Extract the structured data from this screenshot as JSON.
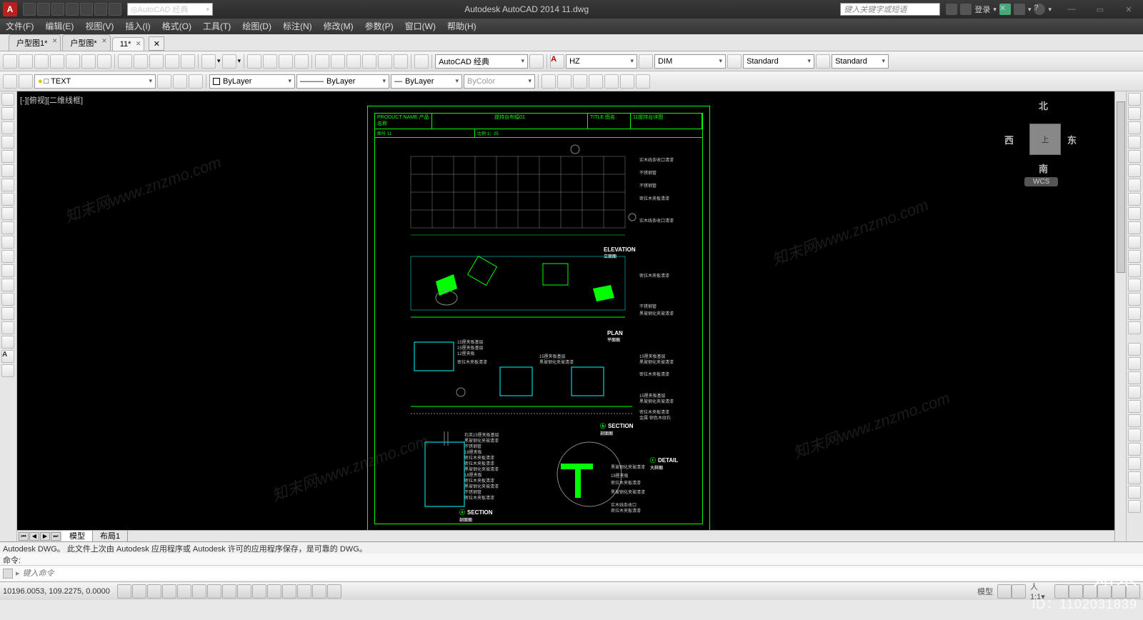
{
  "titlebar": {
    "logo": "A",
    "workspace": "AutoCAD 经典",
    "app_title": "Autodesk AutoCAD 2014   11.dwg",
    "search_placeholder": "键入关键字或短语",
    "login_label": "登录",
    "min": "—",
    "max": "▭",
    "close": "✕"
  },
  "menubar": [
    "文件(F)",
    "编辑(E)",
    "视图(V)",
    "插入(I)",
    "格式(O)",
    "工具(T)",
    "绘图(D)",
    "标注(N)",
    "修改(M)",
    "参数(P)",
    "窗口(W)",
    "帮助(H)"
  ],
  "filetabs": [
    {
      "label": "户型图1*",
      "active": false
    },
    {
      "label": "户型图*",
      "active": false
    },
    {
      "label": "11*",
      "active": true
    }
  ],
  "row1": {
    "workspace_dd": "AutoCAD 经典",
    "font": "HZ",
    "dim": "DIM",
    "std1": "Standard",
    "std2": "Standard"
  },
  "row2": {
    "text_layer": "□ TEXT",
    "layer": "ByLayer",
    "ltype": "ByLayer",
    "lweight": "ByLayer",
    "plot": "ByColor"
  },
  "canvas": {
    "label": "[-][俯视][二维线框]",
    "viewcube": {
      "n": "北",
      "s": "南",
      "e": "东",
      "w": "西",
      "top": "上",
      "wcs": "WCS"
    },
    "model_tabs": [
      "模型",
      "布局1"
    ]
  },
  "drawing": {
    "header": {
      "prodname_lbl": "PRODUCT NAME\n产品名称",
      "title": "提持台布幅01",
      "title_lbl": "TITLE\n图名",
      "title_val": "11提持台详图",
      "no": "图号   11",
      "scale": "比例   1：25"
    },
    "labels": {
      "elevation": "ELEVATION",
      "elevation_sub": "立面图",
      "plan": "PLAN",
      "plan_sub": "平面图",
      "section": "SECTION",
      "section_sub": "剖面图",
      "detail": "DETAIL",
      "detail_sub": "大样图"
    },
    "notes": [
      "实木线条收口清漆",
      "不锈钢管",
      "不锈钢管",
      "密拉木夹板清漆",
      "实木线条收口清漆",
      "密拉木夹板清漆",
      "不锈钢管",
      "黑玻钢化夹玻清漆",
      "15厘夹板基层",
      "15厘夹板基层",
      "12厘夹板",
      "密拉木夹板清漆",
      "15厘夹板基层",
      "黑玻钢化夹玻清漆",
      "密拉木夹板清漆",
      "15厘夹板基层",
      "黑玻钢化夹玻清漆",
      "密拉木夹板清漆",
      "金属·铜色木纹石",
      "石英15厘夹板基层",
      "黑玻钢化夹玻清漆",
      "不锈钢管",
      "18厘夹板",
      "密拉木夹板清漆",
      "密拉木夹板清漆",
      "黑玻钢化夹玻清漆",
      "18厘夹板",
      "密拉木夹板清漆",
      "黑玻钢化夹玻清漆",
      "不锈钢管",
      "密拉木夹板清漆",
      "黑玻钢化夹玻清漆",
      "实木线条收口",
      "密拉木夹板清漆"
    ]
  },
  "cmd": {
    "hist": "Autodesk DWG。 此文件上次由 Autodesk 应用程序或 Autodesk 许可的应用程序保存，是可靠的 DWG。",
    "line": "命令:",
    "placeholder": "键入命令"
  },
  "status": {
    "coords": "10196.0053, 109.2275, 0.0000",
    "model": "模型",
    "scale": "1:1",
    "anno": "人"
  },
  "watermark": {
    "brand": "知末",
    "id": "ID：1102031839",
    "diag": "知末网www.znzmo.com"
  }
}
